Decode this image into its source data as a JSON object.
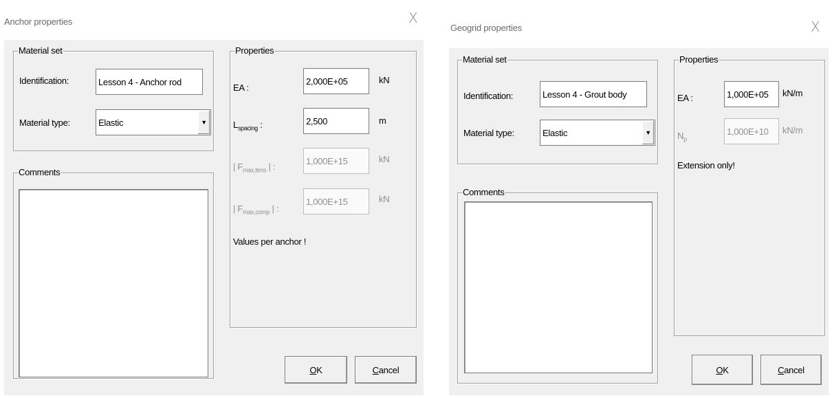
{
  "anchor_dialog": {
    "title": "Anchor properties",
    "close_glyph": "X",
    "material_set": {
      "group_label": "Material set",
      "identification_label": "Identification:",
      "identification_value": "Lesson 4 - Anchor rod",
      "material_type_label": "Material type:",
      "material_type_value": "Elastic"
    },
    "comments": {
      "group_label": "Comments",
      "value": ""
    },
    "properties": {
      "group_label": "Properties",
      "ea_label": "EA :",
      "ea_value": "2,000E+05",
      "ea_unit": "kN",
      "lspacing_label_main": "L",
      "lspacing_label_sub": "spacing",
      "lspacing_label_tail": " :",
      "lspacing_value": "2,500",
      "lspacing_unit": "m",
      "fmax_tens_label_pre": "| F",
      "fmax_tens_label_sub": "max,tens",
      "fmax_tens_label_post": " | :",
      "fmax_tens_value": "1,000E+15",
      "fmax_tens_unit": "kN",
      "fmax_comp_label_pre": "| F",
      "fmax_comp_label_sub": "max,comp",
      "fmax_comp_label_post": " | :",
      "fmax_comp_value": "1,000E+15",
      "fmax_comp_unit": "kN",
      "note": "Values per anchor !"
    },
    "ok_label": "OK",
    "cancel_label": "Cancel"
  },
  "geogrid_dialog": {
    "title": "Geogrid properties",
    "close_glyph": "X",
    "material_set": {
      "group_label": "Material set",
      "identification_label": "Identification:",
      "identification_value": "Lesson 4 - Grout body",
      "material_type_label": "Material type:",
      "material_type_value": "Elastic"
    },
    "comments": {
      "group_label": "Comments",
      "value": ""
    },
    "properties": {
      "group_label": "Properties",
      "ea_label": "EA :",
      "ea_value": "1,000E+05",
      "ea_unit": "kN/m",
      "np_label_main": "N",
      "np_label_sub": "p",
      "np_value": "1,000E+10",
      "np_unit": "kN/m",
      "note": "Extension only!"
    },
    "ok_label": "OK",
    "cancel_label": "Cancel"
  }
}
